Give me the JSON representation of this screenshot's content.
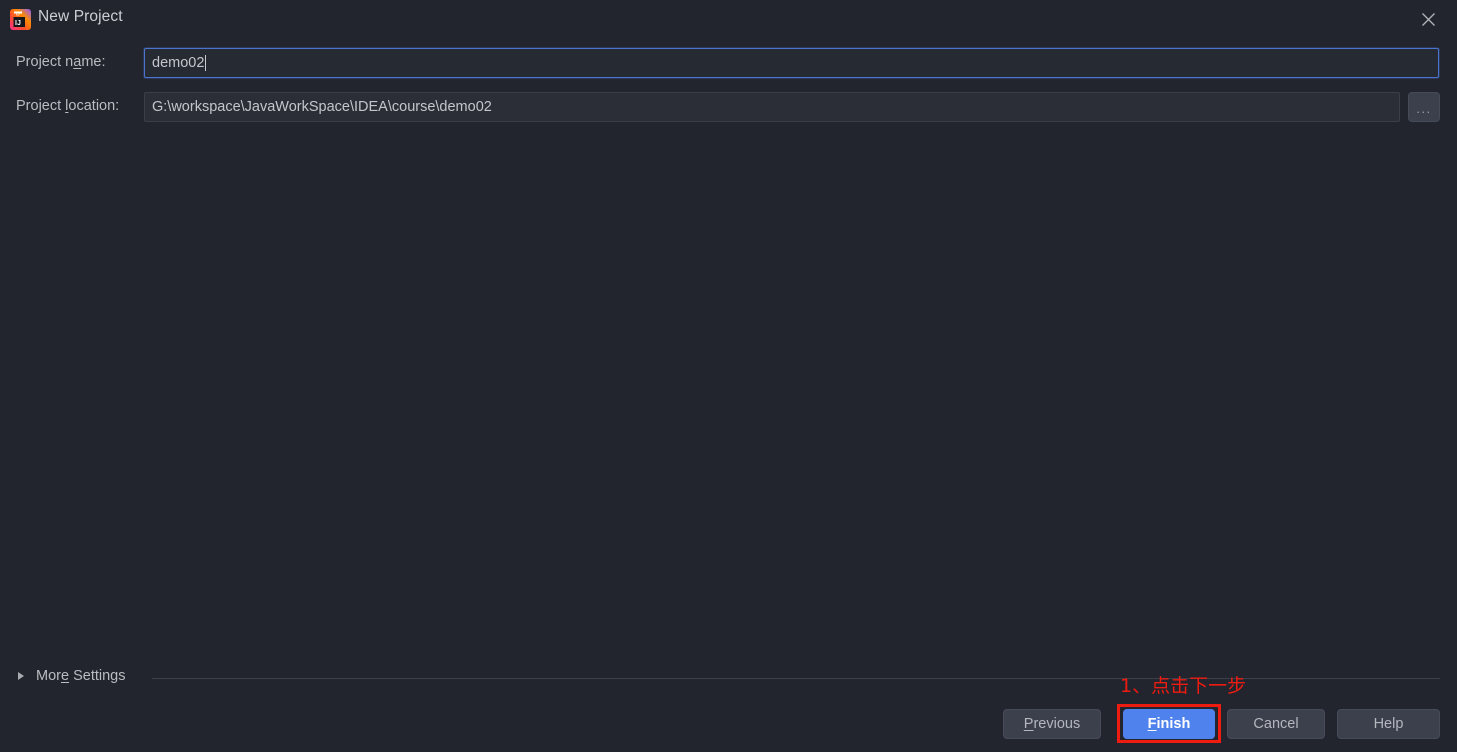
{
  "window": {
    "title": "New Project",
    "app_icon": "intellij-idea-logo",
    "close_icon": "close-icon"
  },
  "form": {
    "project_name": {
      "label_prefix": "Project n",
      "label_mnemonic": "a",
      "label_suffix": "me:",
      "value": "demo02",
      "placeholder": ""
    },
    "project_location": {
      "label_prefix": "Project ",
      "label_mnemonic": "l",
      "label_suffix": "ocation:",
      "value": "G:\\workspace\\JavaWorkSpace\\IDEA\\course\\demo02",
      "placeholder": "",
      "browse_label": "...",
      "browse_icon": "ellipsis-icon"
    }
  },
  "more_settings": {
    "prefix": "Mor",
    "mnemonic": "e",
    "suffix": " Settings",
    "expander_icon": "chevron-right-icon",
    "expanded": false
  },
  "buttons": {
    "previous": {
      "prefix": "",
      "mnemonic": "P",
      "suffix": "revious"
    },
    "finish": {
      "prefix": "",
      "mnemonic": "F",
      "suffix": "inish"
    },
    "cancel": {
      "prefix": "Cancel",
      "mnemonic": "",
      "suffix": ""
    },
    "help": {
      "prefix": "Help",
      "mnemonic": "",
      "suffix": ""
    }
  },
  "annotation": {
    "text": "1、点击下一步",
    "color": "#ee1b11",
    "target": "finish-button"
  },
  "colors": {
    "background": "#22252d",
    "field_background": "#2b2e37",
    "focus_border": "#4b74cf",
    "default_button_background": "#5082ee",
    "button_background": "#3b404c",
    "text": "#b9bcc1",
    "annotation_red": "#ee1b11"
  }
}
